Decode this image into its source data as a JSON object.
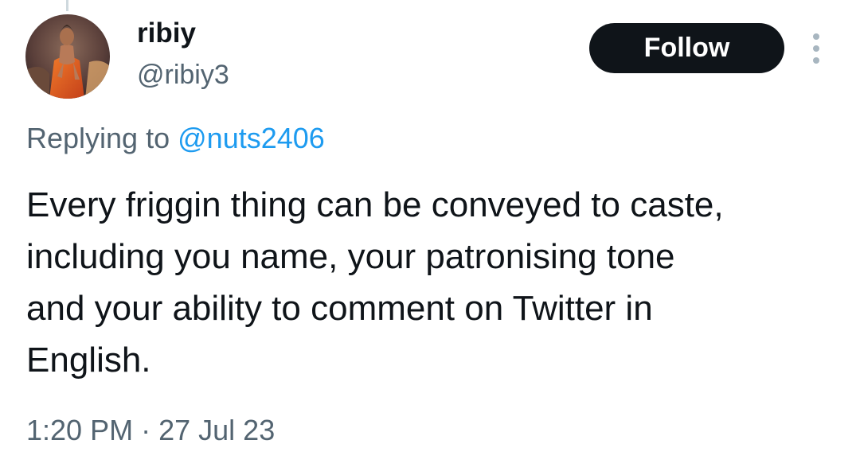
{
  "author": {
    "display_name": "ribiy",
    "handle": "@ribiy3",
    "avatar": "avatar-painting-figure-in-orange-robe"
  },
  "header": {
    "follow_label": "Follow",
    "more_icon": "vertical-ellipsis-icon"
  },
  "reply": {
    "prefix": "Replying to",
    "mention": "@nuts2406"
  },
  "tweet": {
    "lines": [
      "Every friggin thing can be conveyed to caste,",
      "including you name, your patronising tone",
      "and your ability to comment on Twitter in",
      "English."
    ]
  },
  "meta": {
    "time": "1:20 PM",
    "separator": "·",
    "date": "27 Jul 23"
  },
  "colors": {
    "text_primary": "#0f1419",
    "text_secondary": "#536471",
    "link": "#1d9bf0",
    "follow_bg": "#0f1419",
    "follow_text": "#ffffff"
  }
}
